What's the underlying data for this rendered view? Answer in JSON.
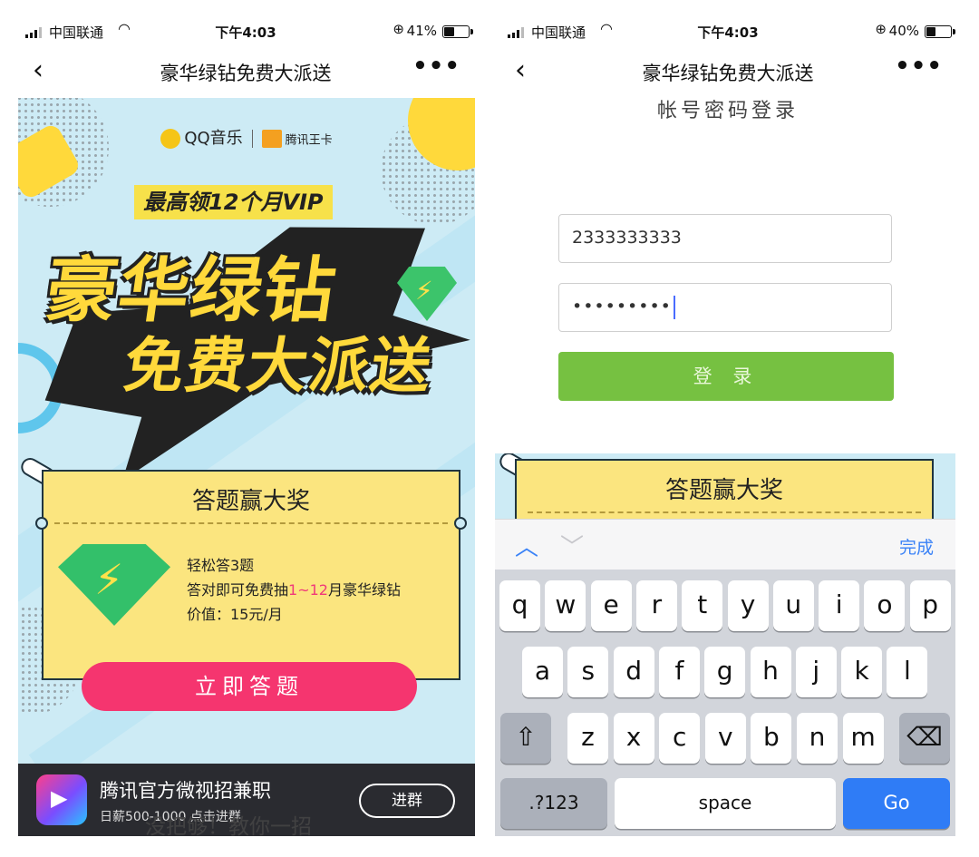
{
  "status_left": {
    "carrier": "中国联通",
    "time": "下午4:03",
    "battery_pct": "41%",
    "battery_level": 0.41
  },
  "status_right": {
    "carrier": "中国联通",
    "time": "下午4:03",
    "battery_pct": "40%",
    "battery_level": 0.4
  },
  "nav": {
    "back_icon": "chevron-left-icon",
    "title": "豪华绿钻免费大派送",
    "more_icon": "more-dots-icon"
  },
  "poster": {
    "brand_qq": "QQ音乐",
    "brand_card": "腾讯王卡",
    "vip_line": "最高领12个月VIP",
    "big_title_1": "豪华绿钻",
    "big_title_2": "免费大派送",
    "ticket_title": "答题赢大奖",
    "ticket_line1": "轻松答3题",
    "ticket_line2_a": "答对即可免费抽",
    "ticket_line2_hl": "1~12",
    "ticket_line2_b": "月豪华绿钻",
    "ticket_line3": "价值：15元/月",
    "cta": "立即答题"
  },
  "ad": {
    "title": "腾讯官方微视招兼职",
    "subtitle": "日薪500-1000 点击进群",
    "button": "进群"
  },
  "caption": "没把够！教你一招",
  "login": {
    "header": "帐号密码登录",
    "account_value": "2333333333",
    "password_mask": "•••••••••",
    "login_button": "登 录"
  },
  "toolbar": {
    "done": "完成"
  },
  "keyboard": {
    "row1": [
      "q",
      "w",
      "e",
      "r",
      "t",
      "y",
      "u",
      "i",
      "o",
      "p"
    ],
    "row2": [
      "a",
      "s",
      "d",
      "f",
      "g",
      "h",
      "j",
      "k",
      "l"
    ],
    "row3": [
      "z",
      "x",
      "c",
      "v",
      "b",
      "n",
      "m"
    ],
    "numbers": ".?123",
    "space": "space",
    "go": "Go"
  },
  "colors": {
    "accent_green": "#76c141",
    "cta_pink": "#f5356f",
    "ios_blue": "#2f7cf6",
    "poster_yellow": "#ffd93b"
  }
}
